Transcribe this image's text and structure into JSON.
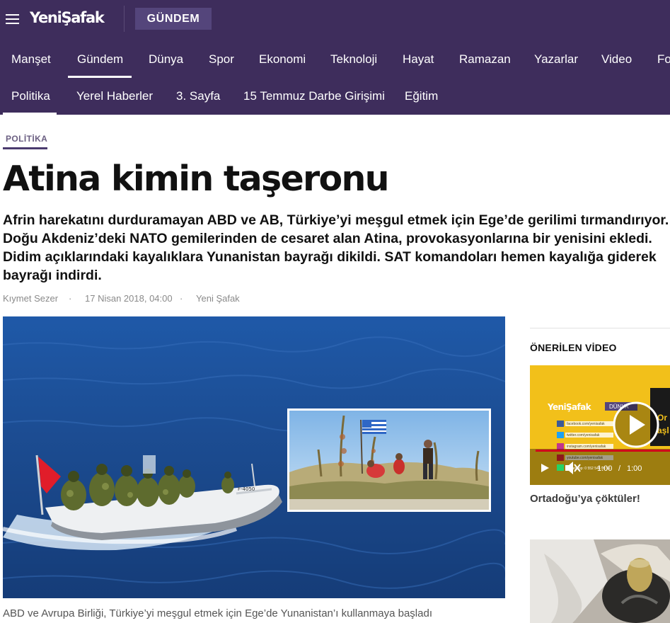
{
  "header": {
    "logo": "YeniŞafak",
    "section": "GÜNDEM"
  },
  "nav": {
    "primary": [
      "Manşet",
      "Gündem",
      "Dünya",
      "Spor",
      "Ekonomi",
      "Teknoloji",
      "Hayat",
      "Ramazan",
      "Yazarlar",
      "Video",
      "Fo"
    ],
    "active_primary": "Gündem",
    "secondary": [
      "Politika",
      "Yerel Haberler",
      "3. Sayfa",
      "15 Temmuz Darbe Girişimi",
      "Eğitim"
    ],
    "active_secondary": "Politika"
  },
  "article": {
    "category": "POLİTİKA",
    "title": "Atina kimin taşeronu",
    "summary": "Afrin harekatını durduramayan ABD ve AB, Türkiye’yi meşgul etmek için Ege’de gerilimi tırmandırıyor. Doğu Akdeniz’deki NATO gemilerinden de cesaret alan Atina, provokasyonlarına bir yenisini ekledi. Didim açıklarındaki kayalıklara Yunanistan bayrağı dikildi. SAT komandoları hemen kayalığa giderek bayrağı indirdi.",
    "author": "Kıymet Sezer",
    "dot": "·",
    "date": "17 Nisan 2018, 04:00",
    "source": "Yeni Şafak",
    "boat_number": "F-4050",
    "caption": "ABD ve Avrupa Birliği, Türkiye’yi meşgul etmek için Ege’de Yunanistan’ı kullanmaya başladı"
  },
  "sidebar": {
    "heading": "ÖNERİLEN VİDEO",
    "video": {
      "logo": "YeniŞafak",
      "tag": "DÜNYA",
      "side_text_1": "Or",
      "side_text_2": "aşl",
      "social_lines": [
        "facebook.com/yenisafak",
        "twitter.com/yenisafak",
        "instagram.com/yenisafak",
        "youtube.com/yenisafak",
        "Whatsapp: 0 552 546 99 55"
      ],
      "time_current": "1:00",
      "time_sep": "/",
      "time_total": "1:00",
      "title": "Ortadoğu’ya çöktüler!"
    }
  },
  "colors": {
    "header_bg": "#3e2d5c",
    "badge_bg": "#54457b",
    "sea": "#1d4b90",
    "video_bg": "#f2c01a",
    "progress": "#d0021b"
  },
  "icons": [
    "hamburger-menu-icon",
    "play-icon",
    "mute-icon",
    "greek-flag-icon",
    "turkish-flag-icon"
  ]
}
